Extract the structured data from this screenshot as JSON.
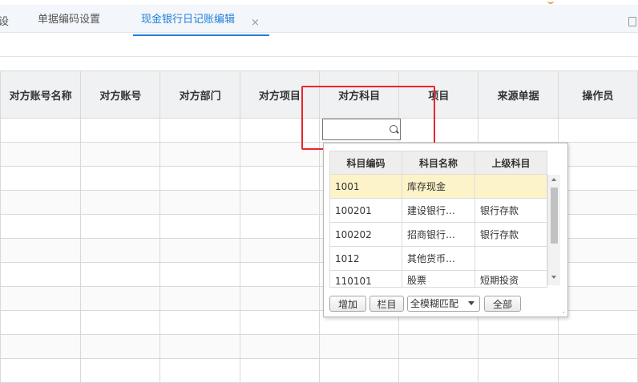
{
  "tabs": [
    {
      "label": "单据编码设置",
      "active": false
    },
    {
      "label": "现金银行日记账编辑",
      "active": true,
      "closable": true
    }
  ],
  "partial_tab_label": "设",
  "close_glyph": "×",
  "grid": {
    "columns": [
      "对方账号名称",
      "对方账号",
      "对方部门",
      "对方项目",
      "对方科目",
      "项目",
      "来源单据",
      "操作员"
    ]
  },
  "lookup": {
    "columns": [
      "科目编码",
      "科目名称",
      "上级科目"
    ],
    "rows": [
      {
        "code": "1001",
        "name": "库存现金",
        "parent": "",
        "selected": true
      },
      {
        "code": "100201",
        "name": "建设银行…",
        "parent": "银行存款",
        "selected": false
      },
      {
        "code": "100202",
        "name": "招商银行…",
        "parent": "银行存款",
        "selected": false
      },
      {
        "code": "1012",
        "name": "其他货币…",
        "parent": "",
        "selected": false
      },
      {
        "code": "110101",
        "name": "股票",
        "parent": "短期投资",
        "selected": false
      }
    ],
    "buttons": {
      "add": "增加",
      "columns": "栏目",
      "all": "全部"
    },
    "match_mode": "全模糊匹配"
  },
  "colors": {
    "accent": "#1e7fd8",
    "highlight_box": "#e8262b",
    "selected_row": "#fdf3c9"
  }
}
